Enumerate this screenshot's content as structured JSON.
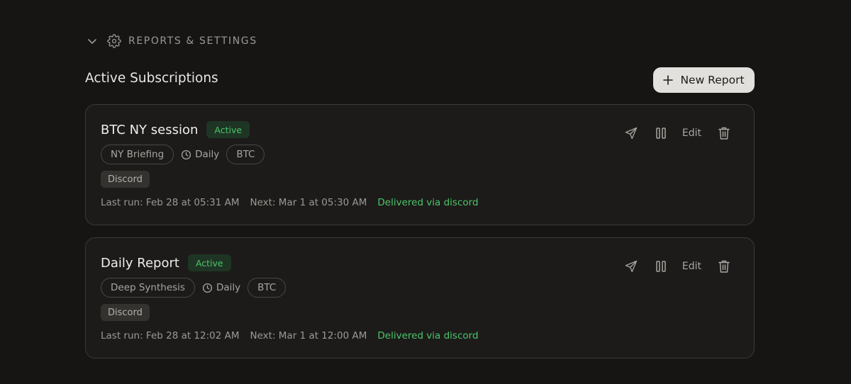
{
  "section": {
    "title": "REPORTS & SETTINGS",
    "chevron_icon": "chevron-down-icon",
    "gear_icon": "gear-icon"
  },
  "subscriptions": {
    "heading": "Active Subscriptions",
    "new_report_label": "New Report"
  },
  "colors": {
    "background": "#161514",
    "card": "#1c1b1a",
    "accent_green": "#4cc46a",
    "primary_button": "#e2e0dd"
  },
  "cards": [
    {
      "name": "BTC NY session",
      "status": "Active",
      "type_tag": "NY Briefing",
      "frequency": "Daily",
      "asset_tag": "BTC",
      "channel": "Discord",
      "last_run": "Last run: Feb 28 at 05:31 AM",
      "next_run": "Next: Mar 1 at 05:30 AM",
      "delivery": "Delivered via discord",
      "edit_label": "Edit"
    },
    {
      "name": "Daily Report",
      "status": "Active",
      "type_tag": "Deep Synthesis",
      "frequency": "Daily",
      "asset_tag": "BTC",
      "channel": "Discord",
      "last_run": "Last run: Feb 28 at 12:02 AM",
      "next_run": "Next: Mar 1 at 12:00 AM",
      "delivery": "Delivered via discord",
      "edit_label": "Edit"
    }
  ]
}
